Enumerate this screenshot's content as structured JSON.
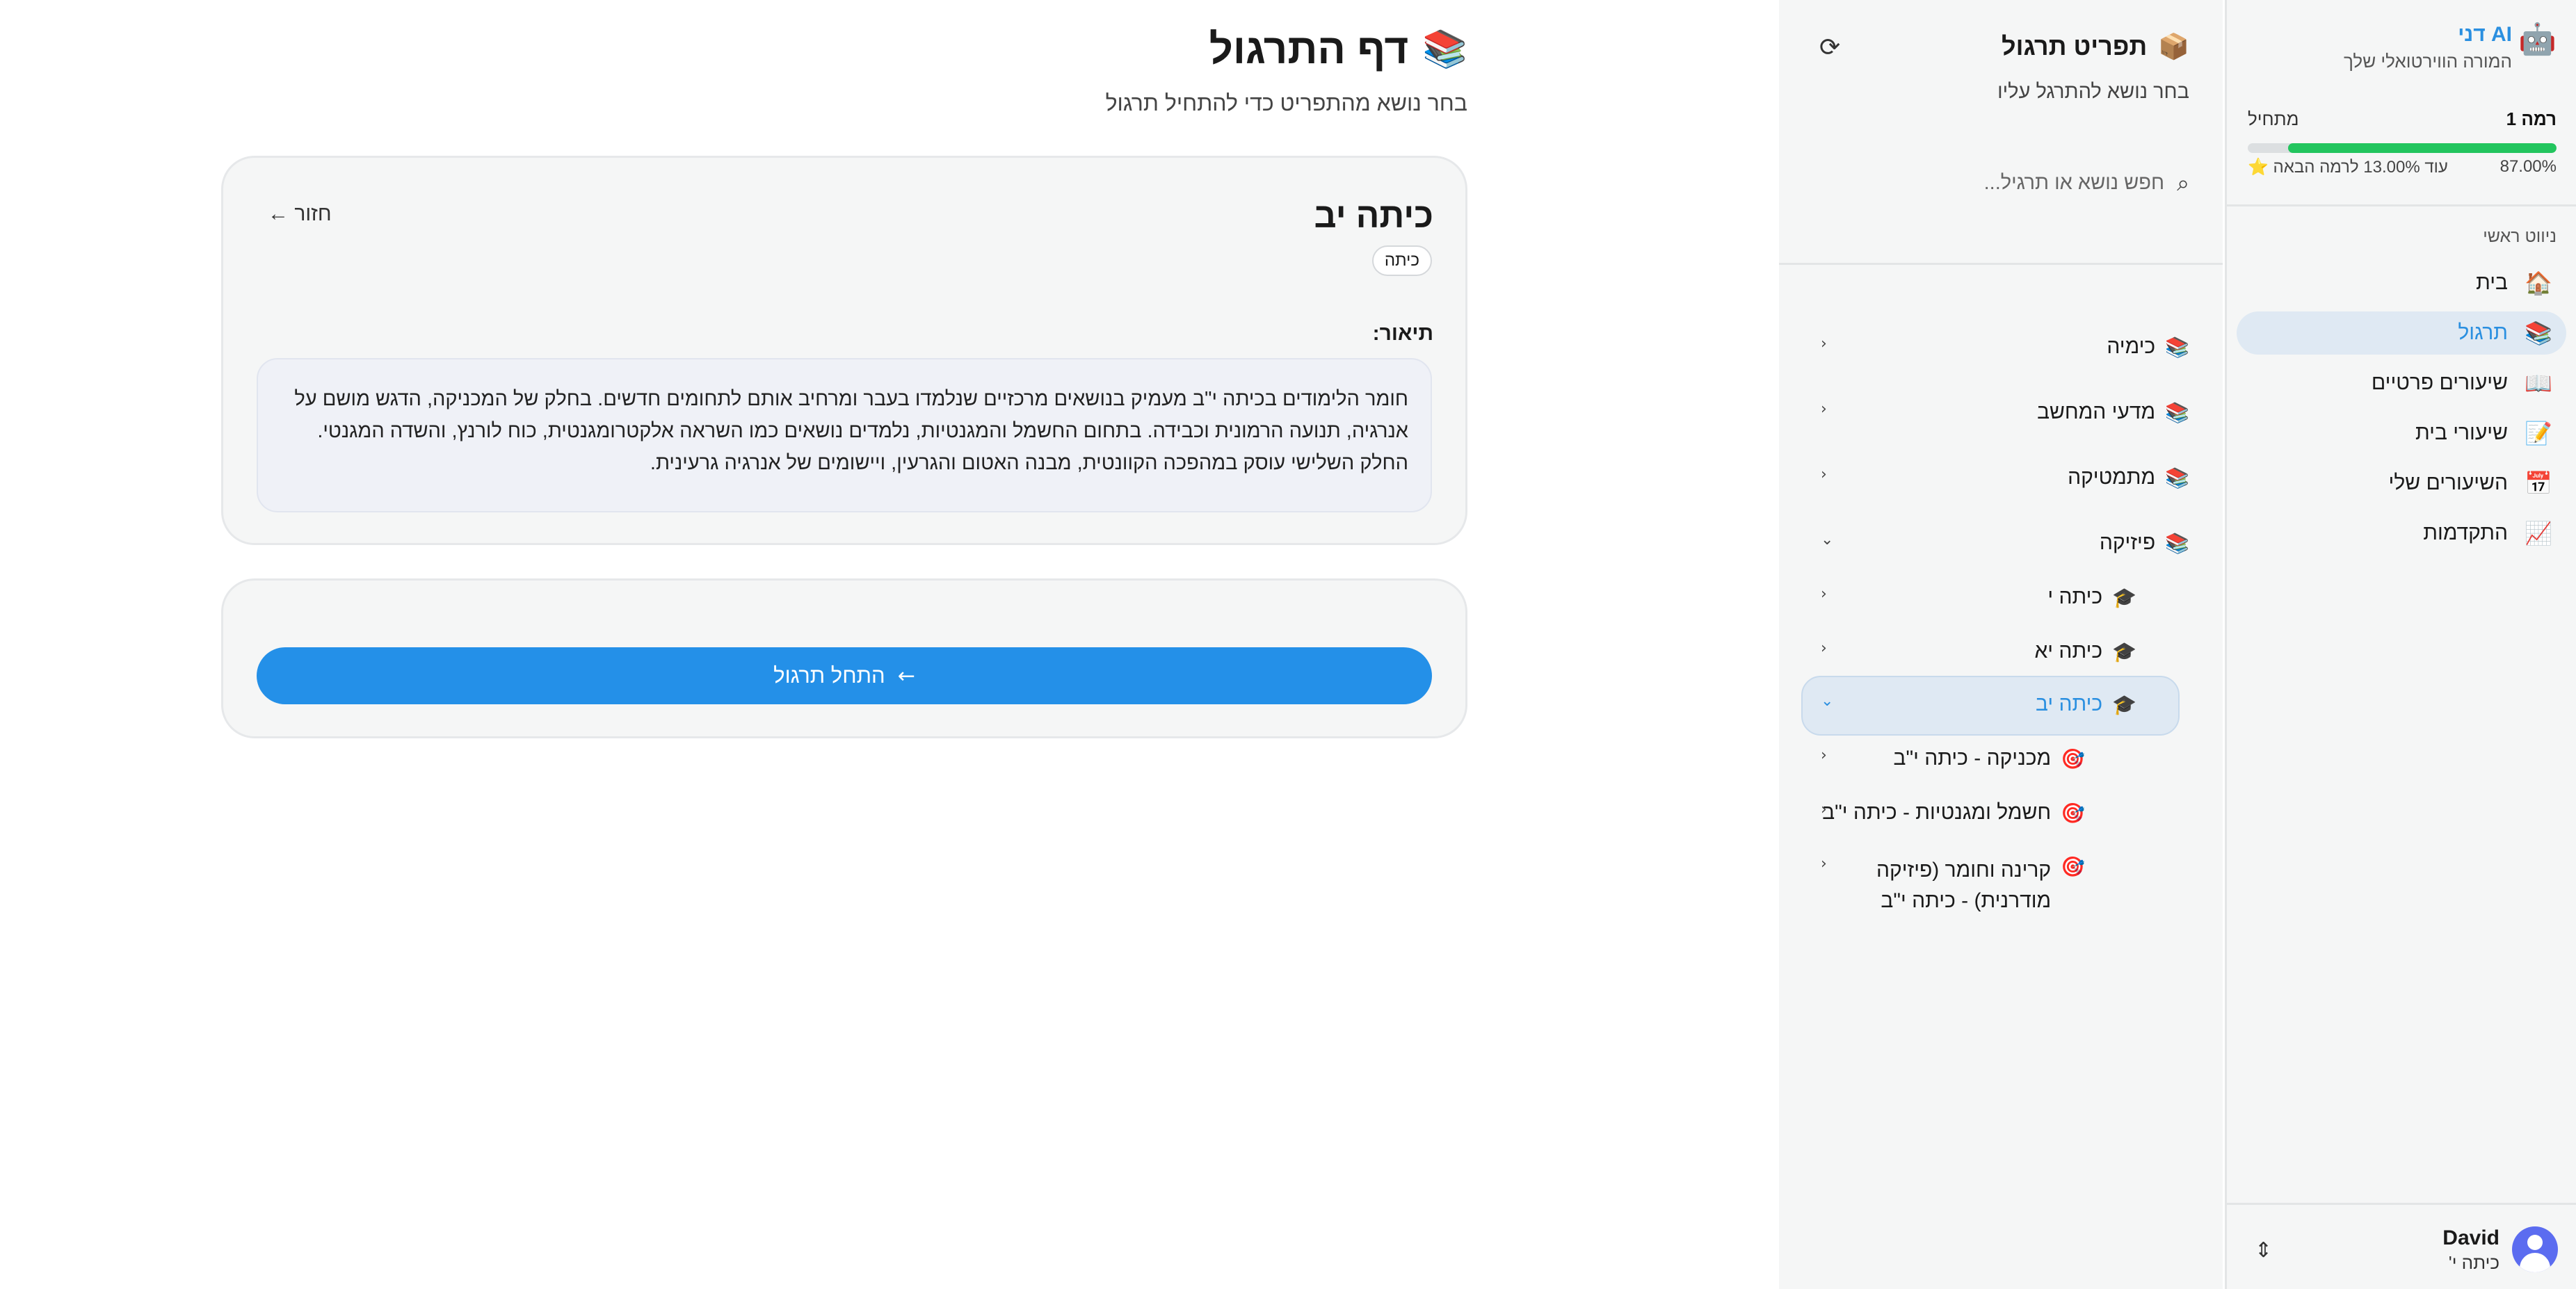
{
  "app": {
    "brand_title": "AI דני",
    "brand_sub": "המורה הווירטואלי שלך",
    "level_label": "רמה 1",
    "rank_label": "מתחיל",
    "progress_value": 87,
    "progress_text": "87.00%",
    "next_level_text": "עוד 13.00% לרמה הבאה ⭐"
  },
  "nav": {
    "heading": "ניווט ראשי",
    "items": [
      {
        "label": "בית",
        "icon": "🏠",
        "active": false
      },
      {
        "label": "תרגול",
        "icon": "📚",
        "active": true
      },
      {
        "label": "שיעורים פרטיים",
        "icon": "📖",
        "active": false
      },
      {
        "label": "שיעורי בית",
        "icon": "📝",
        "active": false
      },
      {
        "label": "השיעורים שלי",
        "icon": "📅",
        "active": false
      },
      {
        "label": "התקדמות",
        "icon": "📈",
        "active": false
      }
    ]
  },
  "user": {
    "name": "David",
    "class": "כיתה י'"
  },
  "menu": {
    "title": "תפריט תרגול",
    "subtitle": "בחר נושא להתרגל עליו",
    "search_placeholder": "חפש נושא או תרגיל...",
    "tree": [
      {
        "label": "כימיה",
        "icon": "📚"
      },
      {
        "label": "מדעי המחשב",
        "icon": "📚"
      },
      {
        "label": "מתמטיקה",
        "icon": "📚"
      },
      {
        "label": "פיזיקה",
        "icon": "📚"
      },
      {
        "label": "כיתה י",
        "icon": "🎓"
      },
      {
        "label": "כיתה יא",
        "icon": "🎓"
      },
      {
        "label": "כיתה יב",
        "icon": "🎓"
      },
      {
        "label": "מכניקה - כיתה י\"ב",
        "icon": "🎯"
      },
      {
        "label": "חשמל ומגנטיות - כיתה י\"ב",
        "icon": "🎯"
      },
      {
        "label": "קרינה וחומר (פיזיקה",
        "label2": "מודרנית) - כיתה י\"ב",
        "icon": "🎯"
      }
    ]
  },
  "main": {
    "title": "דף התרגול",
    "title_icon": "📚",
    "subtitle": "בחר נושא מהתפריט כדי להתחיל תרגול",
    "topic_title": "כיתה יב",
    "back_label": "חזור ←",
    "tag": "כיתה",
    "description_label": "תיאור:",
    "description": "חומר הלימודים בכיתה י\"ב מעמיק בנושאים מרכזיים שנלמדו בעבר ומרחיב אותם לתחומים חדשים. בחלק של המכניקה, הדגש מושם על אנרגיה, תנועה הרמונית וכבידה. בתחום החשמל והמגנטיות, נלמדים נושאים כמו השראה אלקטרומגנטית, כוח לורנץ, והשדה המגנטי. החלק השלישי עוסק במהפכה הקוונטית, מבנה האטום והגרעין, ויישומים של אנרגיה גרעינית.",
    "start_button": "התחל תרגול"
  }
}
